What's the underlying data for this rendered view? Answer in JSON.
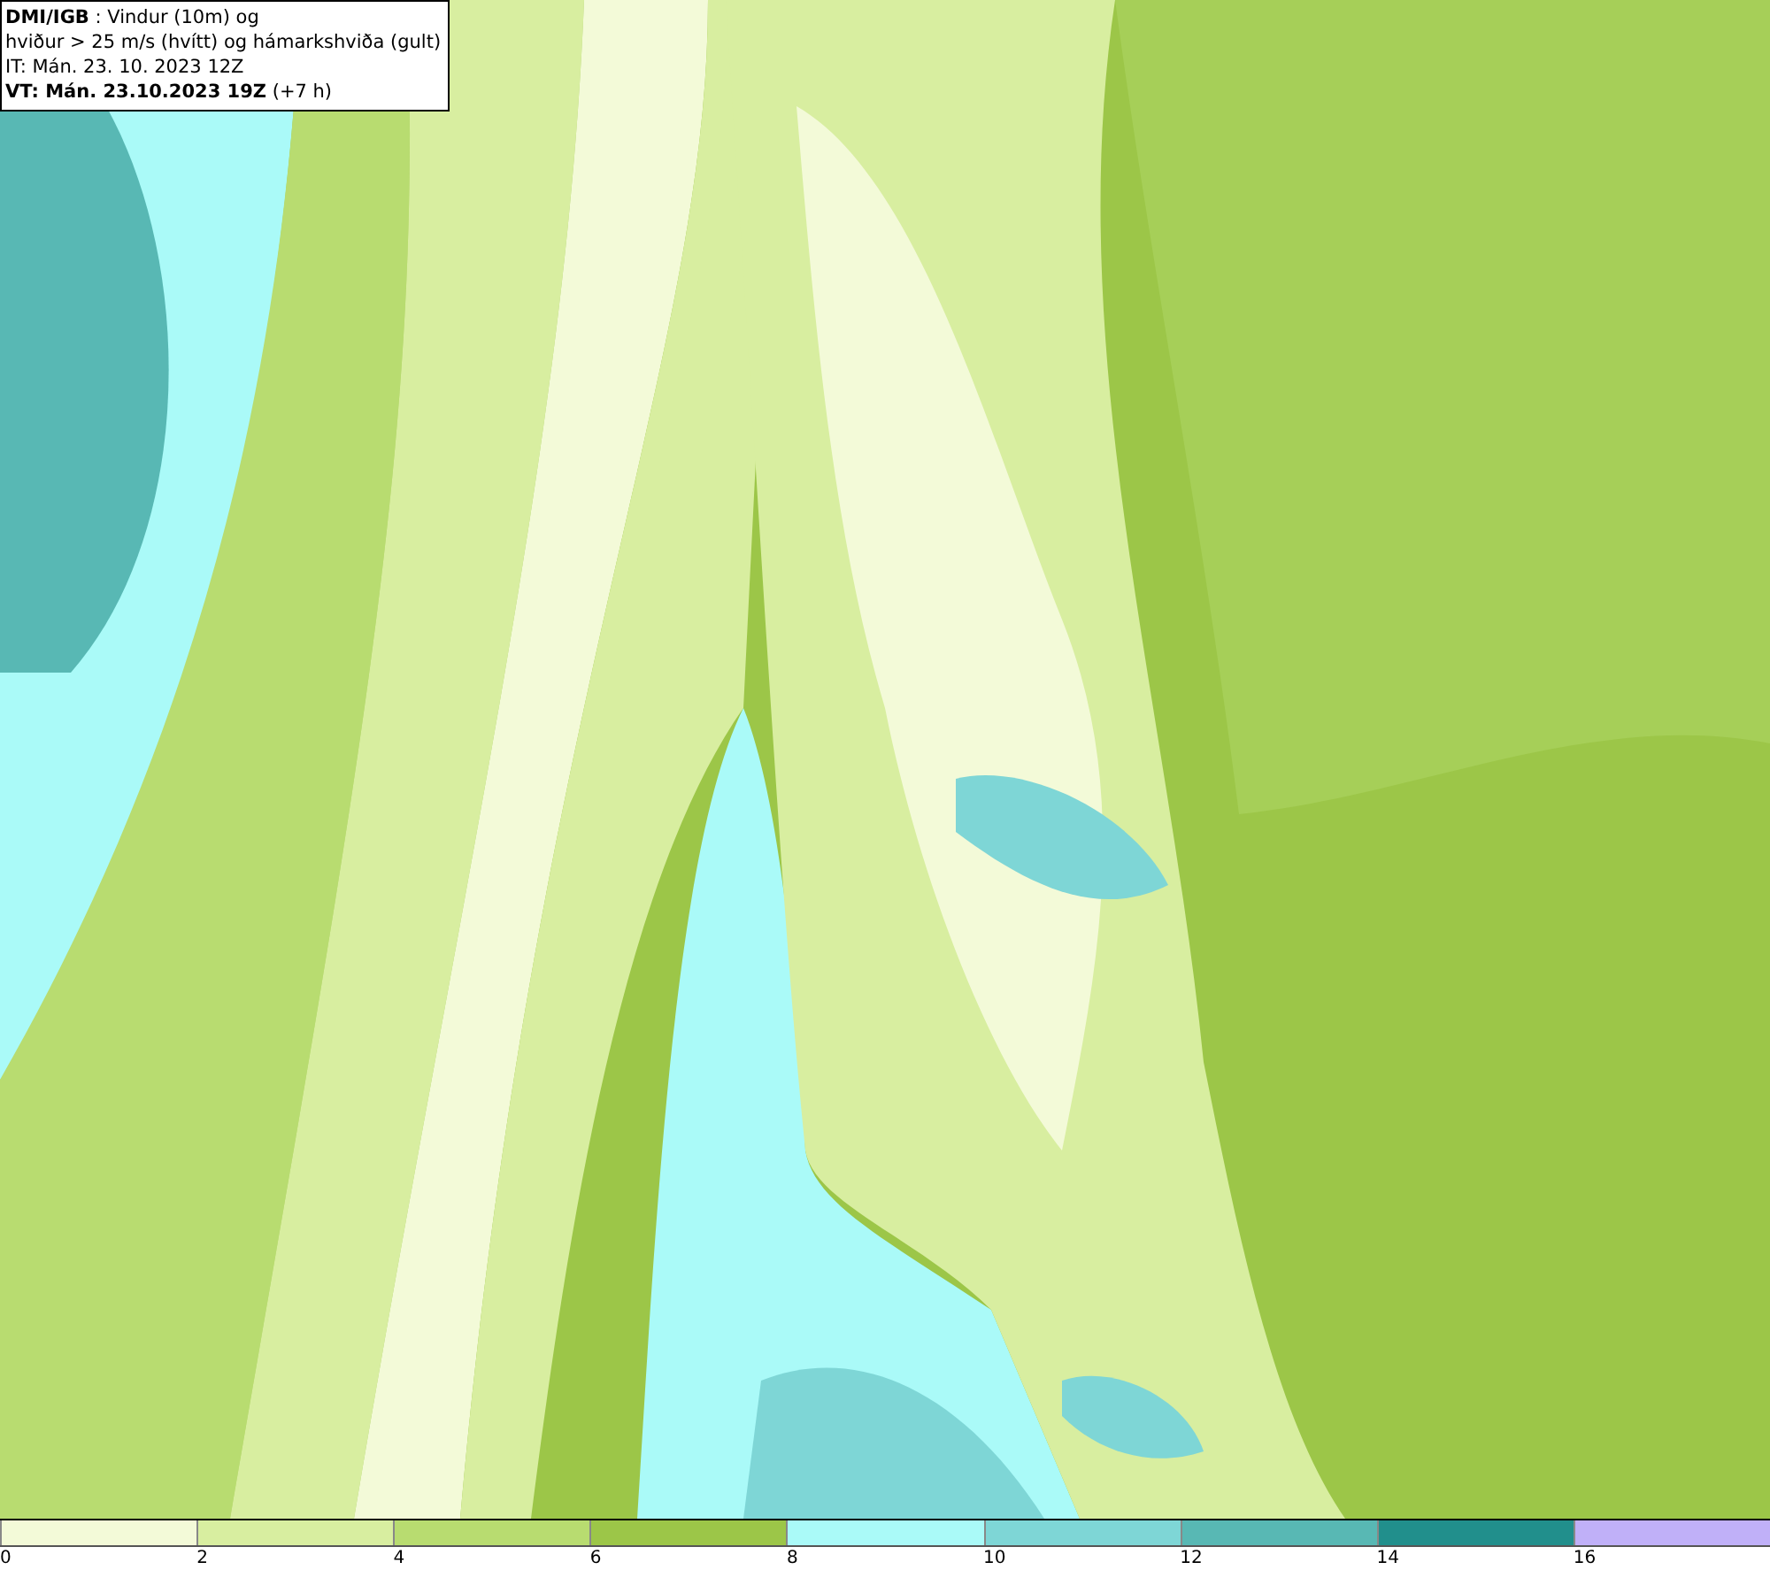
{
  "header": {
    "lines": [
      "**DMI/IGB** : Vindur (10m) og",
      "hviður > 25 m/s (hvítt) og hámarkshviða (gult)",
      "IT: Mán. 23. 10. 2023 12Z",
      "**VT: Mán. 23.10.2023 19Z** (+7 h)"
    ]
  },
  "legend": {
    "bins": [
      {
        "color": "#f3fad8"
      },
      {
        "color": "#d8eea0"
      },
      {
        "color": "#b8dc70"
      },
      {
        "color": "#9cc648"
      },
      {
        "color": "#aafaf8"
      },
      {
        "color": "#7ed6d6"
      },
      {
        "color": "#58b8b4"
      },
      {
        "color": "#218f8c"
      },
      {
        "color": "#c0b0f8"
      }
    ],
    "ticks": [
      "0",
      "2",
      "4",
      "6",
      "8",
      "10",
      "12",
      "14",
      "16"
    ]
  }
}
